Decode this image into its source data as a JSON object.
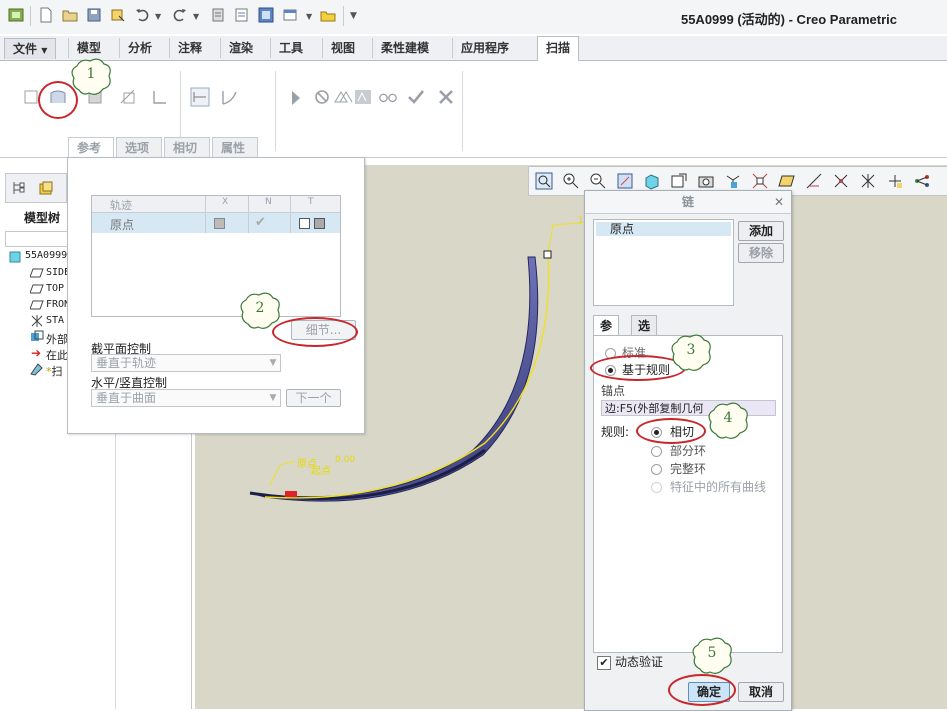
{
  "window": {
    "title": "55A0999 (活动的) - Creo Parametric"
  },
  "ribbon_tabs": [
    {
      "label": "文件",
      "active": false
    },
    {
      "label": "模型",
      "active": false
    },
    {
      "label": "分析",
      "active": false
    },
    {
      "label": "注释",
      "active": false
    },
    {
      "label": "渲染",
      "active": false
    },
    {
      "label": "工具",
      "active": false
    },
    {
      "label": "视图",
      "active": false
    },
    {
      "label": "柔性建模",
      "active": false
    },
    {
      "label": "应用程序",
      "active": false
    },
    {
      "label": "扫描",
      "active": true
    }
  ],
  "dashboard_tabs": [
    "参考",
    "选项",
    "相切",
    "属性"
  ],
  "reference_panel": {
    "columns": [
      "轨迹",
      "X",
      "N",
      "T"
    ],
    "rows": [
      {
        "name": "原点"
      }
    ],
    "details_button": "细节...",
    "section_control_label": "截平面控制",
    "section_control_value": "垂直于轨迹",
    "orientation_label": "水平/竖直控制",
    "orientation_value": "垂直于曲面",
    "next_button": "下一个"
  },
  "model_tree": {
    "label": "模型树",
    "items": [
      "55A0999",
      "SIDE",
      "TOP",
      "FRON",
      "STA",
      "外部",
      "在此",
      "扫"
    ]
  },
  "viewport": {
    "label_origin": "原点",
    "label_dim": "0.00",
    "label_start": "起点",
    "label_top": "1"
  },
  "chain_dialog": {
    "title": "链",
    "list_item": "原点",
    "add_button": "添加",
    "remove_button": "移除",
    "tabs": [
      "参考",
      "选项"
    ],
    "type_options": [
      {
        "label": "标准",
        "selected": false
      },
      {
        "label": "基于规则",
        "selected": true
      }
    ],
    "anchor_label": "锚点",
    "anchor_value": "边:F5(外部复制几何",
    "rule_label": "规则:",
    "rules": [
      {
        "label": "相切",
        "selected": true,
        "enabled": true
      },
      {
        "label": "部分环",
        "selected": false,
        "enabled": true
      },
      {
        "label": "完整环",
        "selected": false,
        "enabled": true
      },
      {
        "label": "特征中的所有曲线",
        "selected": false,
        "enabled": false
      }
    ],
    "dynamic_validate": "动态验证",
    "ok_button": "确定",
    "cancel_button": "取消"
  },
  "callouts": [
    "1",
    "2",
    "3",
    "4",
    "5"
  ],
  "colors": {
    "accent_red": "#c8272b",
    "callout_green": "#3a7a3a",
    "sweep_blue": "#5a5fa8",
    "trajectory_yellow": "#f0e020"
  }
}
